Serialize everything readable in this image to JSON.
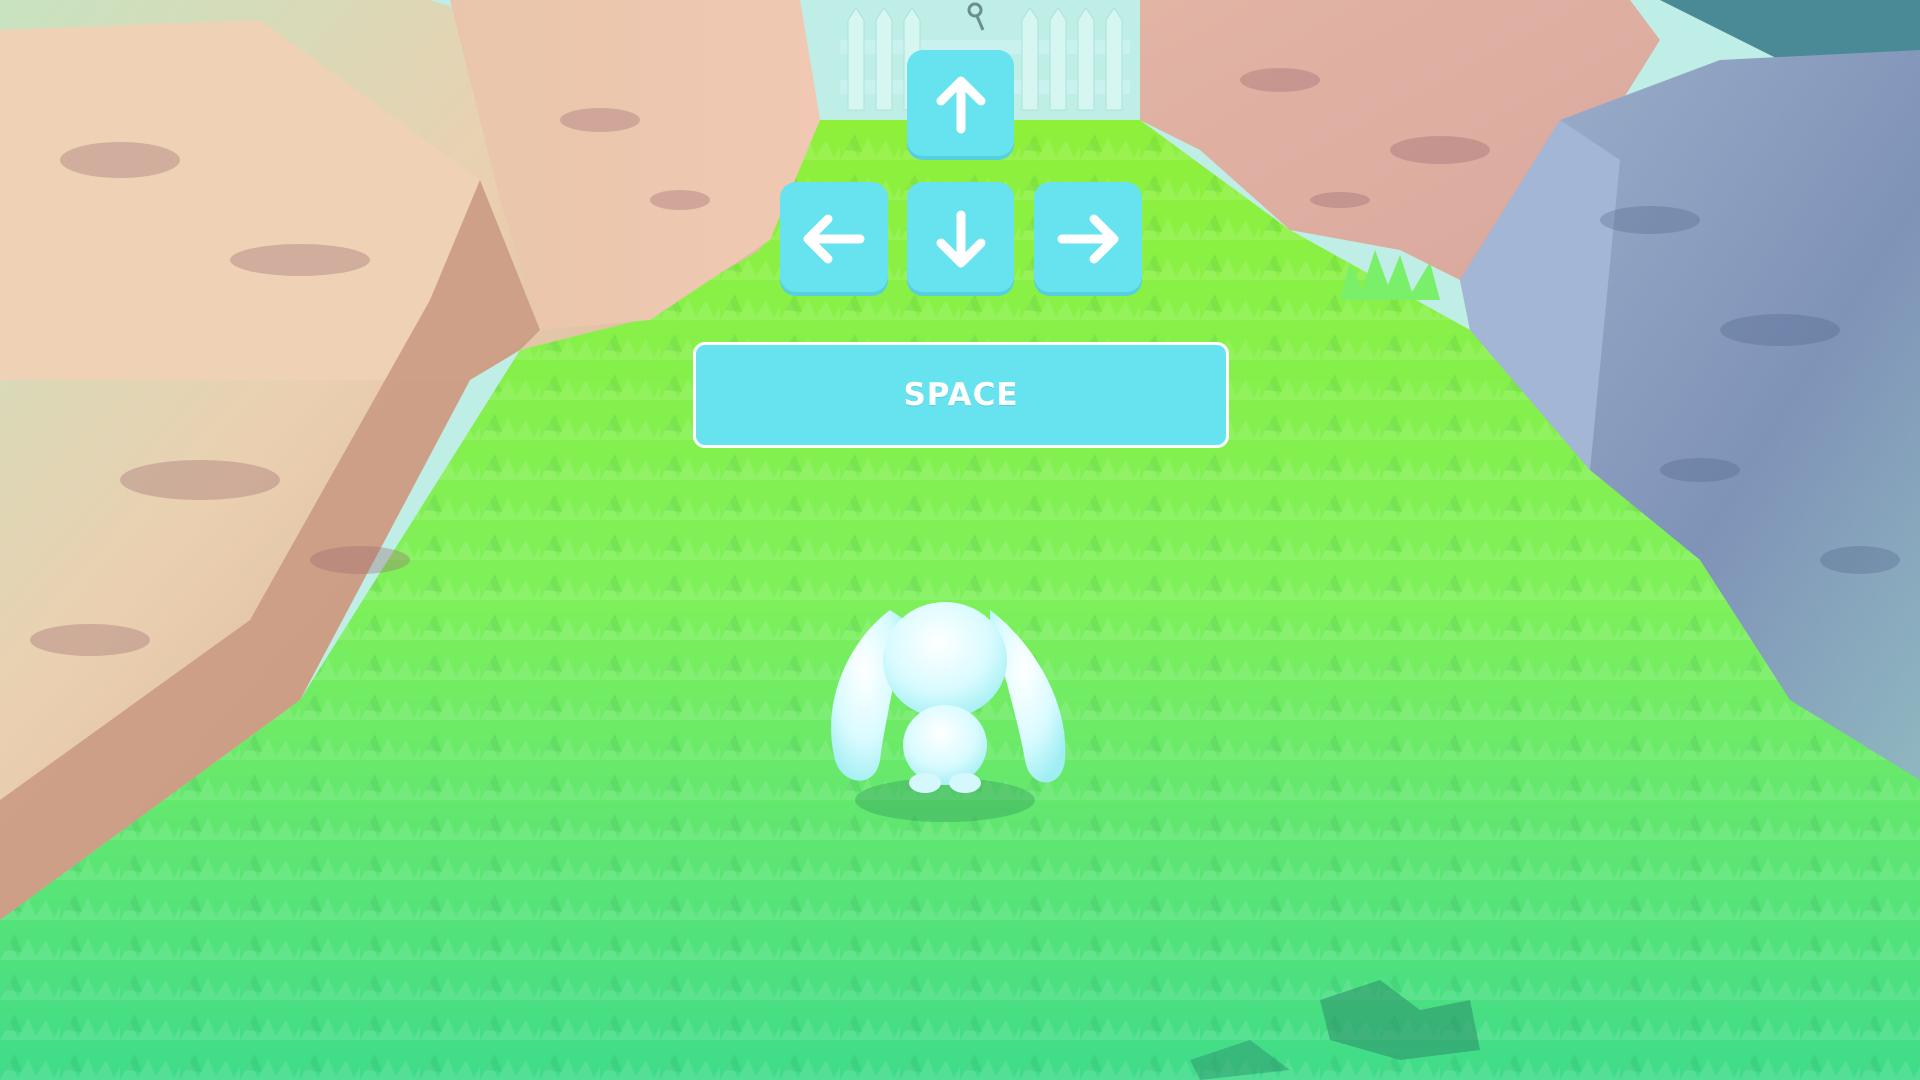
{
  "controls": {
    "arrow_keys": [
      {
        "id": "up",
        "icon": "arrow-up-icon"
      },
      {
        "id": "left",
        "icon": "arrow-left-icon"
      },
      {
        "id": "down",
        "icon": "arrow-down-icon"
      },
      {
        "id": "right",
        "icon": "arrow-right-icon"
      }
    ],
    "space_label": "SPACE"
  },
  "colors": {
    "key_fill": "#66e3ef",
    "key_text": "#ffffff",
    "grass": "#8ff03a",
    "grass_foreground": "#4ae07a",
    "rock_warm": "#e8c3a3",
    "rock_cool": "#8fa3c0",
    "fence": "#c9f2ee",
    "bunny": "#dffaff"
  },
  "scene": {
    "character": "bunny",
    "objects": [
      "picket-fence",
      "key-on-fence",
      "rock-walls",
      "grass-path"
    ]
  }
}
